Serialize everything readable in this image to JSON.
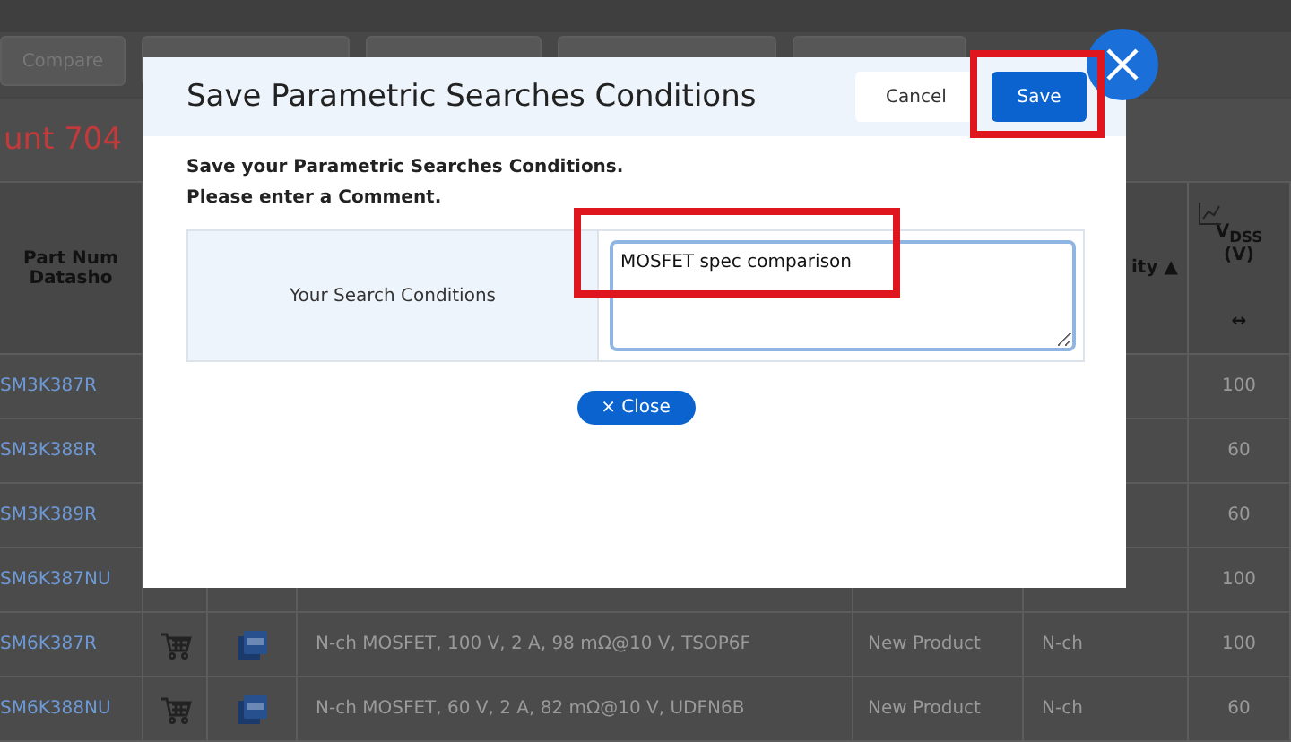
{
  "toolbar": {
    "buttons": [
      {
        "kind": "text",
        "label": "Compare"
      },
      {
        "kind": "blank"
      },
      {
        "kind": "blank"
      },
      {
        "kind": "blank"
      },
      {
        "kind": "blank"
      }
    ]
  },
  "result_heading": "unt 704",
  "table": {
    "header": {
      "part_lines": [
        "Part Num",
        "Datasho"
      ],
      "polarity": "ity ▲",
      "vdss": "V$_{DSS}$",
      "vdss_unit": "(V)",
      "vdss_arrows": "↔"
    },
    "rows": [
      {
        "part": "SM3K387R",
        "vdss": "100"
      },
      {
        "part": "SM3K388R",
        "vdss": "60"
      },
      {
        "part": "SM3K389R",
        "vdss": "60"
      },
      {
        "part": "SM6K387NU",
        "vdss": "100"
      },
      {
        "part": "SM6K387R",
        "cart": true,
        "pdf": true,
        "description": "N-ch MOSFET, 100 V, 2 A, 98 mΩ@10 V, TSOP6F",
        "status": "New Product",
        "polarity": "N-ch",
        "vdss": "100"
      },
      {
        "part": "SM6K388NU",
        "cart": true,
        "pdf": true,
        "description": "N-ch MOSFET, 60 V, 2 A, 82 mΩ@10 V, UDFN6B",
        "status": "New Product",
        "polarity": "N-ch",
        "vdss": "60"
      }
    ]
  },
  "dialog": {
    "title": "Save Parametric Searches Conditions",
    "cancel": "Cancel",
    "save": "Save",
    "intro": [
      "Save your Parametric Searches Conditions.",
      "Please enter a Comment."
    ],
    "field_label": "Your Search Conditions",
    "comment": "MOSFET spec comparison",
    "close": "× Close"
  }
}
